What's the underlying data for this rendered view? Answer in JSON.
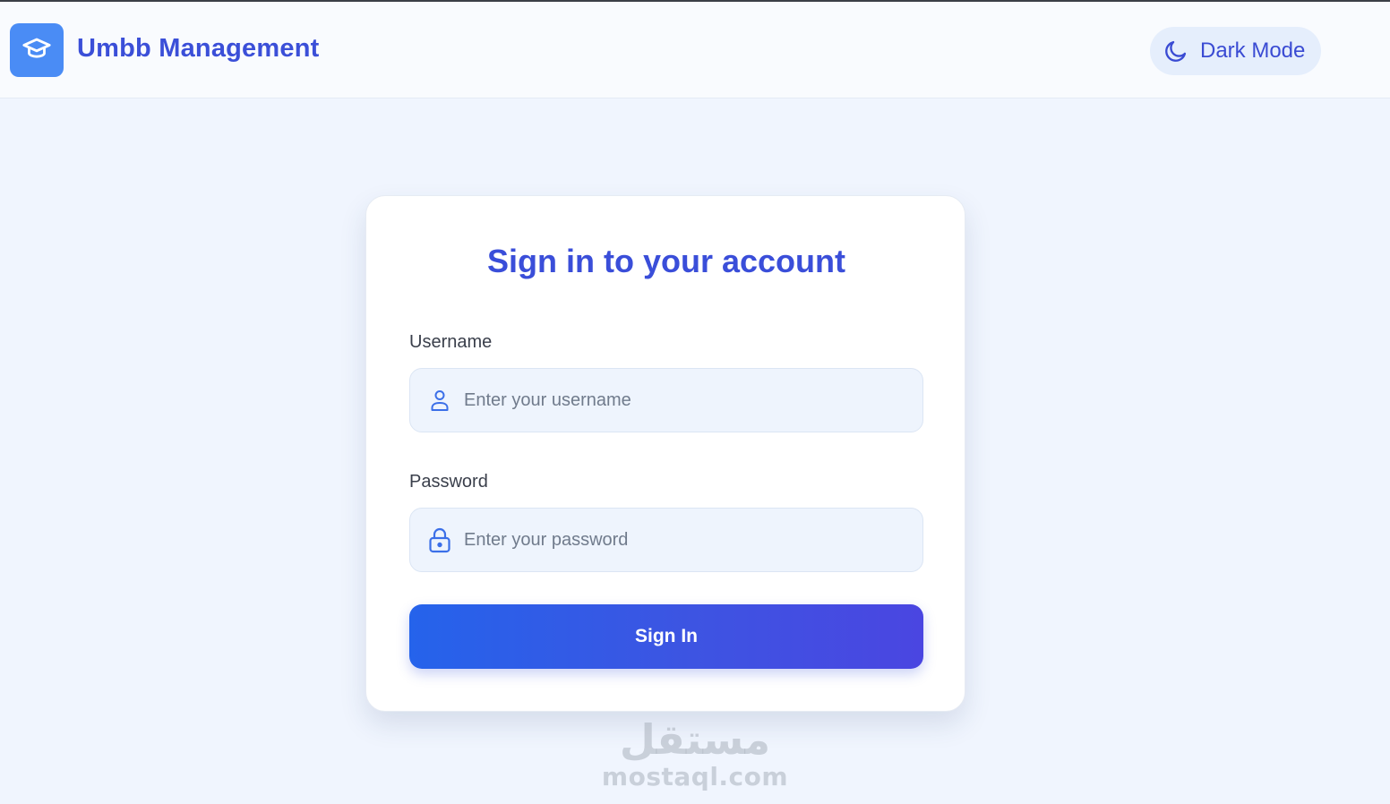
{
  "header": {
    "logo_icon": "graduation-cap-icon",
    "brand": "Umbb Management",
    "theme_toggle": {
      "icon": "moon-icon",
      "label": "Dark Mode"
    }
  },
  "login": {
    "title": "Sign in to your account",
    "username": {
      "label": "Username",
      "icon": "user-icon",
      "placeholder": "Enter your username",
      "value": ""
    },
    "password": {
      "label": "Password",
      "icon": "lock-icon",
      "placeholder": "Enter your password",
      "value": ""
    },
    "submit_label": "Sign In"
  },
  "watermark": {
    "arabic": "مستقل",
    "domain": "mostaql.com"
  },
  "colors": {
    "brand": "#3b4fd8",
    "logo_bg": "#4a8cf5",
    "page_bg": "#f0f5fe",
    "button_gradient_start": "#2563eb",
    "button_gradient_end": "#4a46e1"
  }
}
